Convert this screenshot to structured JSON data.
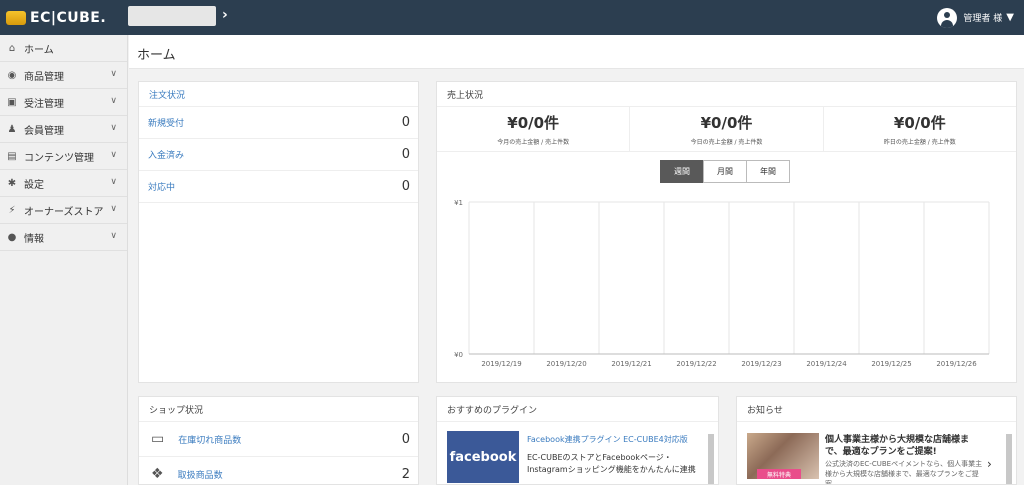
{
  "header": {
    "logo_text": "EC|CUBE.",
    "user_name": "管理者 様",
    "shop_chevron": "›",
    "user_chevron": "▼"
  },
  "sidebar": {
    "items": [
      {
        "label": "ホーム",
        "icon": "home-icon",
        "glyph": "⌂",
        "chevron": ""
      },
      {
        "label": "商品管理",
        "icon": "box-icon",
        "glyph": "◉",
        "chevron": "∨"
      },
      {
        "label": "受注管理",
        "icon": "cart-icon",
        "glyph": "▣",
        "chevron": "∨"
      },
      {
        "label": "会員管理",
        "icon": "users-icon",
        "glyph": "♟",
        "chevron": "∨"
      },
      {
        "label": "コンテンツ管理",
        "icon": "document-icon",
        "glyph": "▤",
        "chevron": "∨"
      },
      {
        "label": "設定",
        "icon": "gear-icon",
        "glyph": "✱",
        "chevron": "∨"
      },
      {
        "label": "オーナーズストア",
        "icon": "plug-icon",
        "glyph": "⚡",
        "chevron": "∨"
      },
      {
        "label": "情報",
        "icon": "info-icon",
        "glyph": "●",
        "chevron": "∨"
      }
    ]
  },
  "page": {
    "title": "ホーム"
  },
  "orders": {
    "title": "注文状況",
    "rows": [
      {
        "label": "新規受付",
        "value": "0"
      },
      {
        "label": "入金済み",
        "value": "0"
      },
      {
        "label": "対応中",
        "value": "0"
      }
    ]
  },
  "sales": {
    "title": "売上状況",
    "stats": [
      {
        "value": "¥0/0件",
        "label": "今月の売上金額 / 売上件数"
      },
      {
        "value": "¥0/0件",
        "label": "今日の売上金額 / 売上件数"
      },
      {
        "value": "¥0/0件",
        "label": "昨日の売上金額 / 売上件数"
      }
    ],
    "tabs": [
      {
        "label": "週間",
        "active": true
      },
      {
        "label": "月間",
        "active": false
      },
      {
        "label": "年間",
        "active": false
      }
    ]
  },
  "chart_data": {
    "type": "line",
    "x": [
      "2019/12/19",
      "2019/12/20",
      "2019/12/21",
      "2019/12/22",
      "2019/12/23",
      "2019/12/24",
      "2019/12/25",
      "2019/12/26"
    ],
    "series": [
      {
        "values": [
          0,
          0,
          0,
          0,
          0,
          0,
          0,
          0
        ]
      }
    ],
    "ytick_labels": [
      "¥1",
      "¥0"
    ],
    "ylim": [
      0,
      1
    ],
    "grid": true
  },
  "shop": {
    "title": "ショップ状況",
    "rows": [
      {
        "label": "在庫切れ商品数",
        "value": "0",
        "icon": "inbox-icon",
        "glyph": "▭"
      },
      {
        "label": "取扱商品数",
        "value": "2",
        "icon": "cubes-icon",
        "glyph": "❖"
      }
    ]
  },
  "plugins": {
    "title": "おすすめのプラグイン",
    "item": {
      "logo_text": "facebook",
      "title": "Facebook連携プラグイン EC-CUBE4対応版",
      "description": "EC-CUBEのストアとFacebookページ・Instagramショッピング機能をかんたんに連携"
    }
  },
  "news": {
    "title": "お知らせ",
    "item": {
      "badge": "無料特典",
      "headline": "個人事業主様から大規模な店舗様まで、最適なプランをご提案!",
      "body": "公式決済のEC-CUBEペイメントなら、個人事業主様から大規模な店舗様まで、最適なプランをご提案",
      "chevron": "›"
    }
  }
}
